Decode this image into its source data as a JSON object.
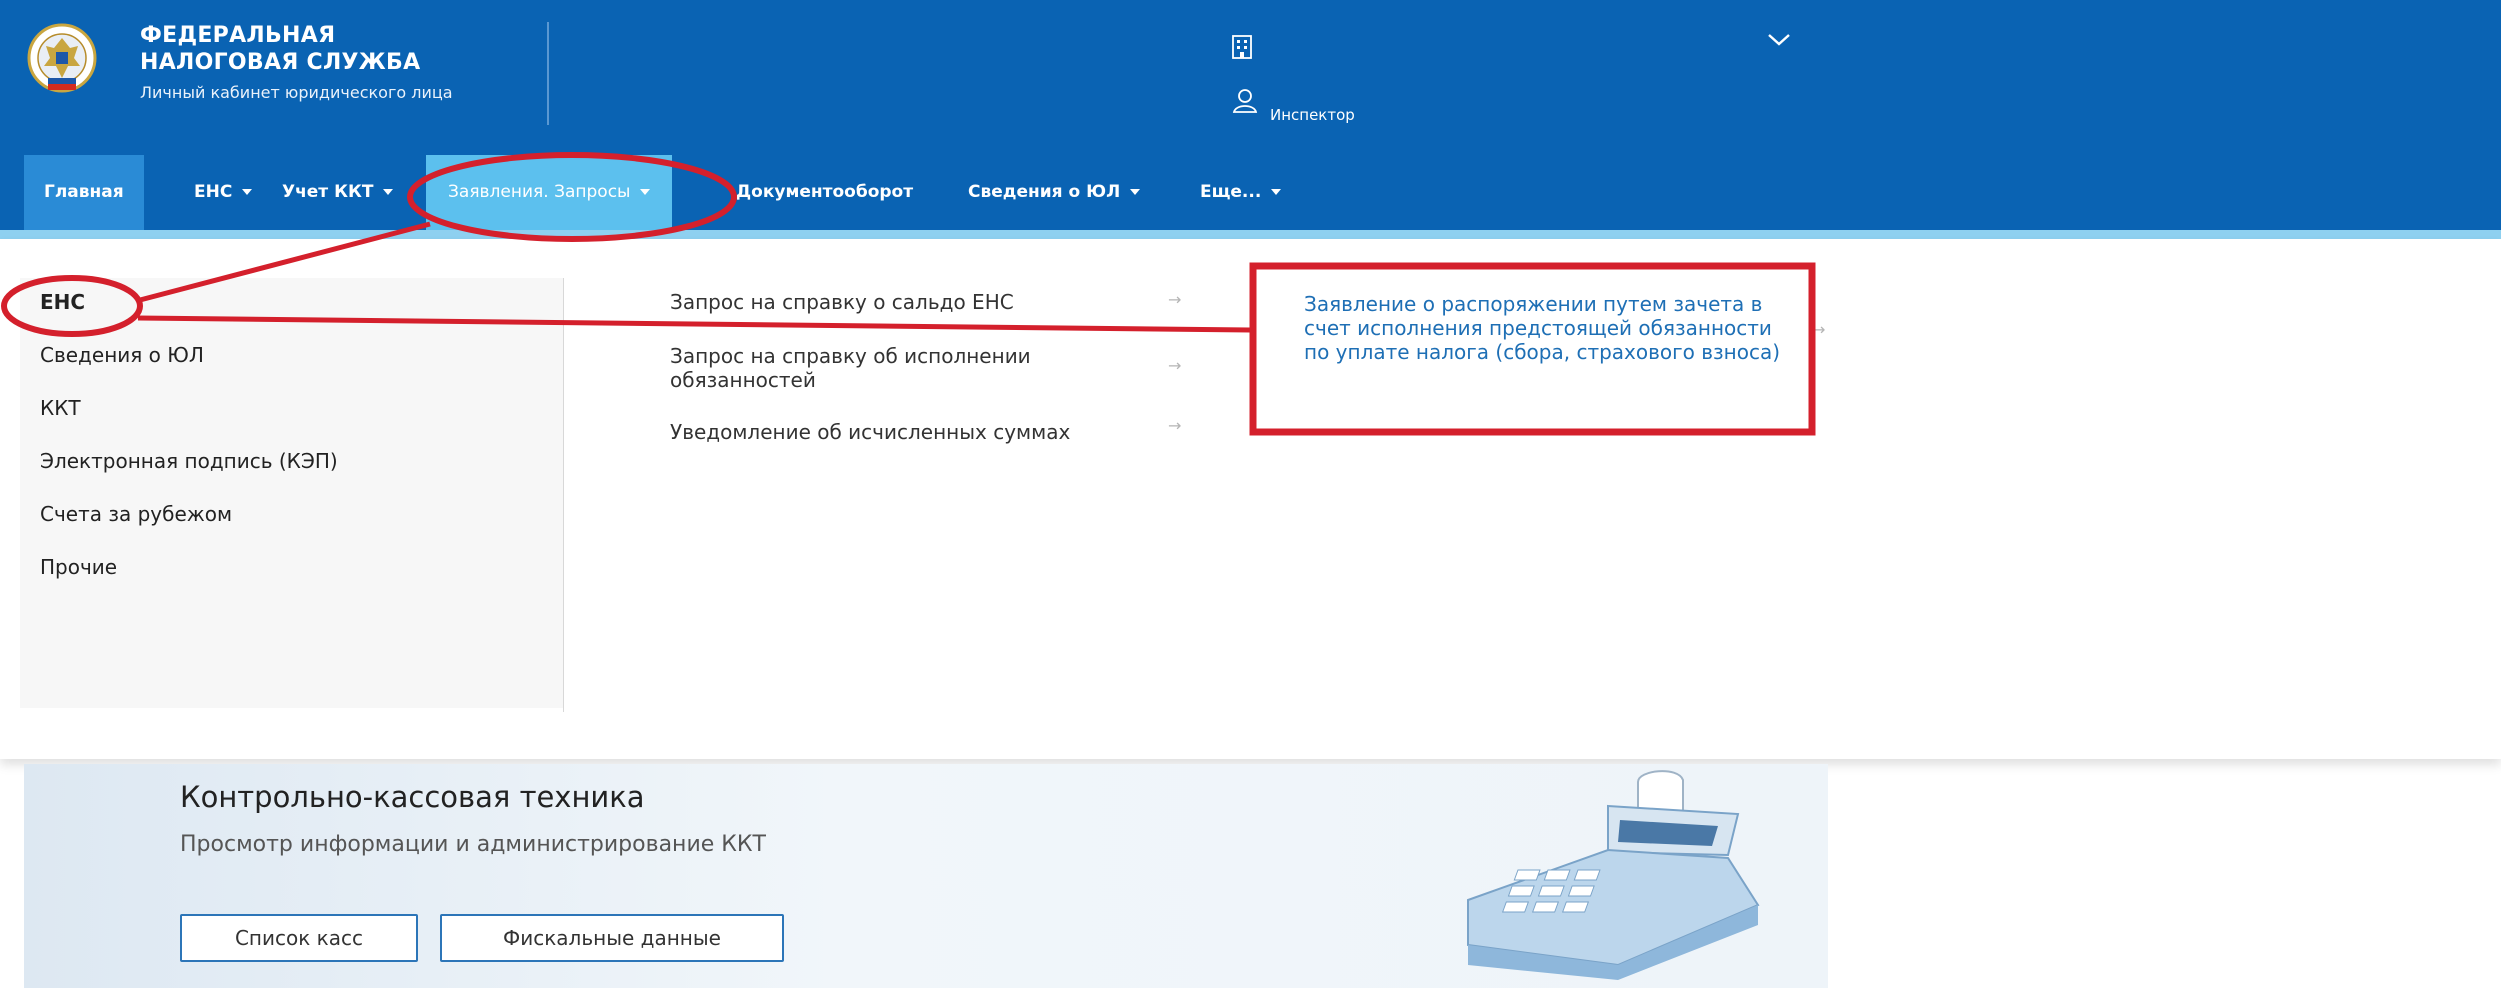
{
  "header": {
    "brand_line1": "ФЕДЕРАЛЬНАЯ",
    "brand_line2": "НАЛОГОВАЯ СЛУЖБА",
    "brand_sub": "Личный кабинет юридического лица",
    "user_label": "Инспектор",
    "icons": [
      "fns-emblem-logo",
      "building-icon",
      "user-icon",
      "chevron-down-icon"
    ]
  },
  "nav": {
    "items": [
      {
        "label": "Главная"
      },
      {
        "label": "ЕНС"
      },
      {
        "label": "Учет ККТ"
      },
      {
        "label": "Заявления. Запросы"
      },
      {
        "label": "Документооборот"
      },
      {
        "label": "Сведения о ЮЛ"
      },
      {
        "label": "Еще..."
      }
    ]
  },
  "dropdown": {
    "categories": [
      "ЕНС",
      "Сведения о ЮЛ",
      "ККТ",
      "Электронная подпись (КЭП)",
      "Счета за рубежом",
      "Прочие"
    ],
    "submenu": [
      "Запрос на справку о сальдо ЕНС",
      "Запрос на справку об исполнении обязанностей",
      "Уведомление об исчисленных суммах"
    ],
    "third_level": "Заявление о распоряжении путем зачета в счет исполнения предстоящей обязанности по уплате налога (сбора, страхового взноса)"
  },
  "banner": {
    "title": "Контрольно-кассовая техника",
    "subtitle": "Просмотр информации и администрирование ККТ",
    "button1": "Список касс",
    "button2": "Фискальные данные"
  },
  "colors": {
    "header_blue": "#0a63b3",
    "active_tab": "#2a8bd6",
    "open_tab": "#5cc0ee",
    "annotation_red": "#d4202c",
    "link_blue": "#1e6fb5"
  }
}
